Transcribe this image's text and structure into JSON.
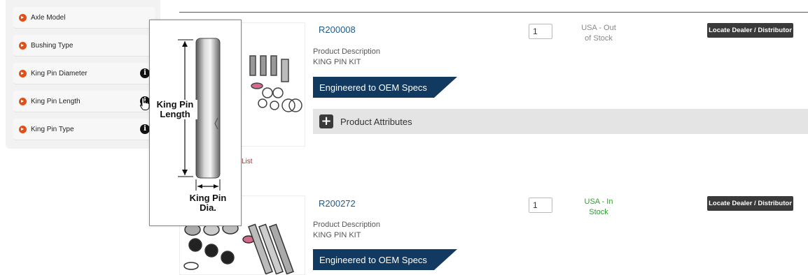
{
  "sidebar": {
    "filters": [
      {
        "label": "Axle Model",
        "has_info": false
      },
      {
        "label": "Bushing Type",
        "has_info": false
      },
      {
        "label": "King Pin Diameter",
        "has_info": true
      },
      {
        "label": "King Pin Length",
        "has_info": true
      },
      {
        "label": "King Pin Type",
        "has_info": true
      }
    ],
    "info_glyph": "i"
  },
  "tooltip": {
    "length_label_1": "King Pin",
    "length_label_2": "Length",
    "dia_label_1": "King Pin",
    "dia_label_2": "Dia."
  },
  "products": [
    {
      "sku": "R200008",
      "description_label": "Product Description",
      "description": "KING PIN KIT",
      "oem_label": "Engineered to OEM Specs",
      "quantity": "1",
      "stock_line1": "USA - Out",
      "stock_line2": "of Stock",
      "dealer_label": "Locate Dealer / Distributor",
      "attributes_label": "Product Attributes",
      "list_link": "List"
    },
    {
      "sku": "R200272",
      "description_label": "Product Description",
      "description": "KING PIN KIT",
      "oem_label": "Engineered to OEM Specs",
      "quantity": "1",
      "stock_line1": "USA - In",
      "stock_line2": "Stock",
      "dealer_label": "Locate Dealer / Distributor"
    }
  ],
  "colors": {
    "filter_arrow": "#e0501b",
    "oem_banner": "#12395f",
    "sku_link": "#1f5a8a",
    "in_stock": "#2f9e2f",
    "out_of_stock": "#888888",
    "dealer_button": "#3a3a3a"
  }
}
